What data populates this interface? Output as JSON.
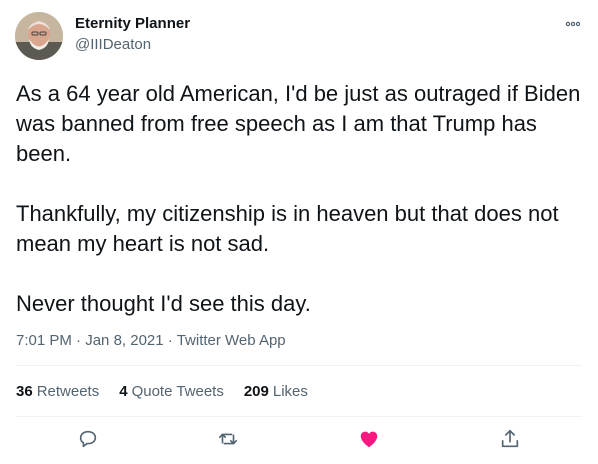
{
  "author": {
    "name": "Eternity Planner",
    "handle": "@IIIDeaton"
  },
  "tweet": {
    "text": "As a 64 year old American, I'd be just as outraged if Biden was banned from free speech as I am that Trump has been.\n\nThankfully, my citizenship is in heaven but that does not mean my heart is not sad.\n\nNever thought I'd see this day."
  },
  "meta": {
    "time": "7:01 PM",
    "date": "Jan 8, 2021",
    "source": "Twitter Web App",
    "separator": "·"
  },
  "stats": {
    "retweets_count": "36",
    "retweets_label": "Retweets",
    "quotes_count": "4",
    "quotes_label": "Quote Tweets",
    "likes_count": "209",
    "likes_label": "Likes"
  },
  "icons": {
    "more": "more-icon",
    "reply": "reply-icon",
    "retweet": "retweet-icon",
    "like": "heart-icon",
    "share": "share-icon"
  },
  "colors": {
    "text": "#0f1419",
    "secondary": "#536471",
    "divider": "#eff3f4",
    "like": "#f91880",
    "icon": "#536471"
  }
}
